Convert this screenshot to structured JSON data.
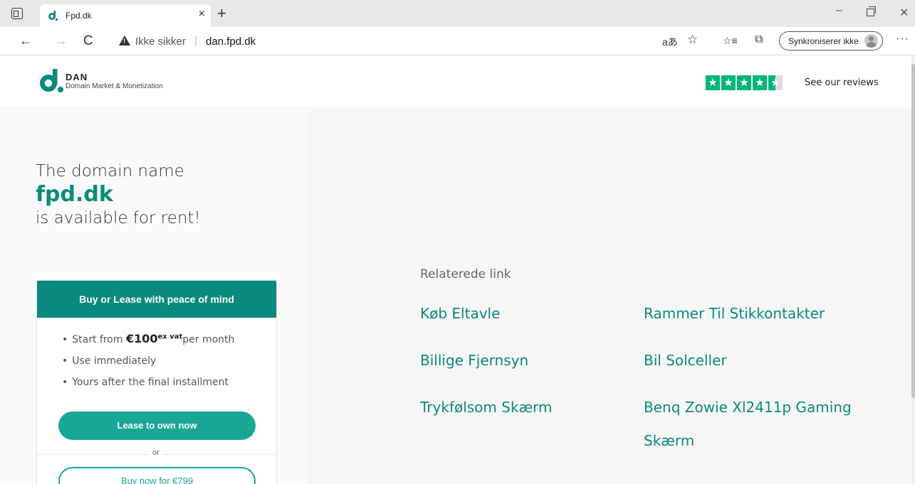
{
  "browser": {
    "tab_title": "Fpd.dk",
    "tab_close": "×",
    "new_tab": "+",
    "security_label": "Ikke sikker",
    "url_separator": "|",
    "url": "dan.fpd.dk",
    "sync_label": "Synkroniserer ikke",
    "more": "···",
    "win_min": "–",
    "win_close": "✕",
    "icons": {
      "back": "←",
      "forward": "→",
      "reload": "C",
      "read_aloud": "aあ",
      "favorite": "☆",
      "favorites": "☆≡",
      "collections": "⧉"
    }
  },
  "header": {
    "logo_name": "DAN",
    "logo_tagline": "Domain Market & Monetization",
    "reviews_link": "See our reviews",
    "rating_stars": 4.5,
    "star_glyph": "★"
  },
  "hero": {
    "line1": "The domain name",
    "domain": "fpd.dk",
    "line2": "is available for rent!"
  },
  "card": {
    "heading": "Buy or Lease with peace of mind",
    "bullet1_prefix": "Start from ",
    "price": "€100",
    "price_sup": "ex vat",
    "bullet1_suffix": "per month",
    "bullet2": "Use immediately",
    "bullet3": "Yours after the final installment",
    "lease_button": "Lease to own now",
    "or": "or",
    "buy_button": "Buy now for €799"
  },
  "related": {
    "title": "Relaterede link",
    "links": [
      "Køb Eltavle",
      "Rammer Til Stikkontakter",
      "Billige Fjernsyn",
      "Bil Solceller",
      "Trykfølsom Skærm",
      "Benq Zowie Xl2411p Gaming Skærm"
    ]
  },
  "colors": {
    "brand": "#0a8a7c",
    "button": "#19a795",
    "trustpilot": "#00b67a"
  }
}
